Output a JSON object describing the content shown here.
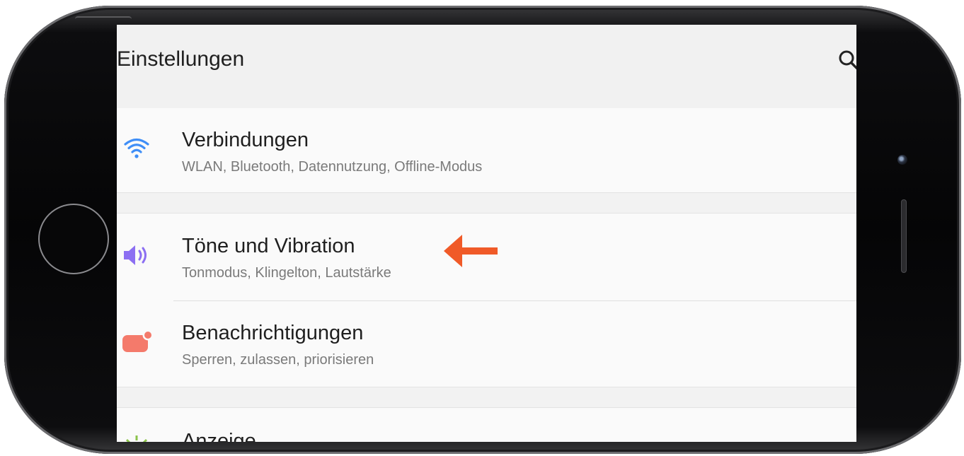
{
  "app": {
    "title": "Einstellungen"
  },
  "header": {
    "search_icon": "search-icon"
  },
  "settings": {
    "items": [
      {
        "icon": "wifi-icon",
        "icon_color": "#3f8ef7",
        "title": "Verbindungen",
        "subtitle": "WLAN, Bluetooth, Datennutzung, Offline-Modus"
      },
      {
        "icon": "speaker-icon",
        "icon_color": "#8c6ff2",
        "title": "Töne und Vibration",
        "subtitle": "Tonmodus, Klingelton, Lautstärke"
      },
      {
        "icon": "notification-icon",
        "icon_color": "#f47a6b",
        "title": "Benachrichtigungen",
        "subtitle": "Sperren, zulassen, priorisieren"
      },
      {
        "icon": "display-icon",
        "icon_color": "#8bc34a",
        "title": "Anzeige"
      }
    ]
  },
  "annotation": {
    "arrow_color": "#f05a28"
  }
}
